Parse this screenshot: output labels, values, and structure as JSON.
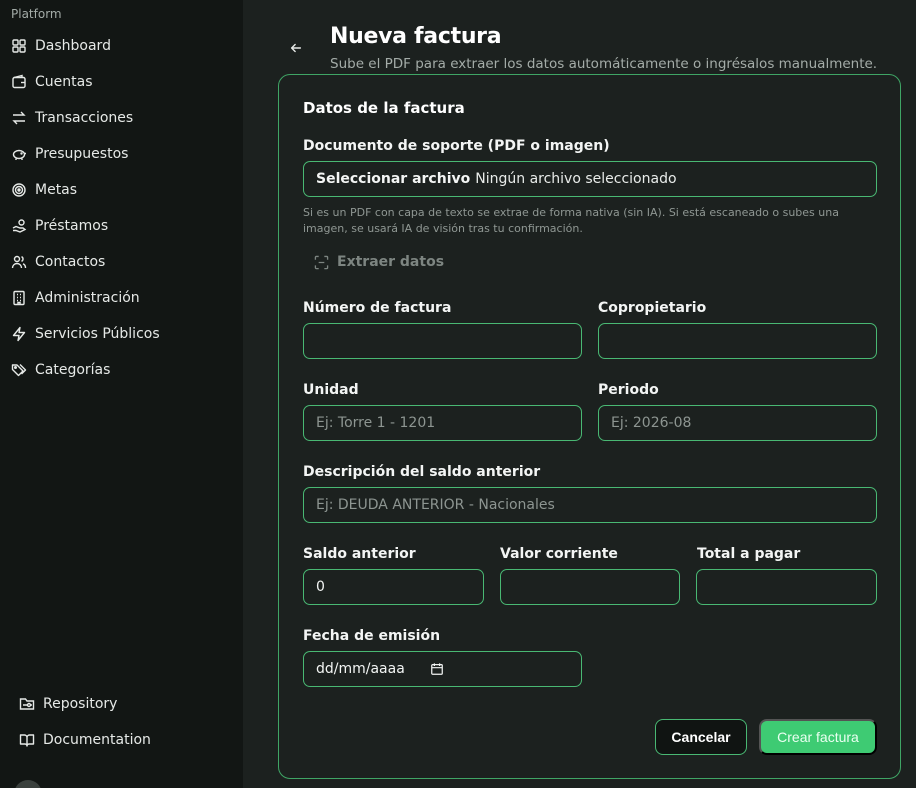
{
  "sidebar": {
    "section_label": "Platform",
    "items": [
      {
        "label": "Dashboard",
        "icon": "grid-icon"
      },
      {
        "label": "Cuentas",
        "icon": "wallet-icon"
      },
      {
        "label": "Transacciones",
        "icon": "arrows-swap-icon"
      },
      {
        "label": "Presupuestos",
        "icon": "piggy-bank-icon"
      },
      {
        "label": "Metas",
        "icon": "target-icon"
      },
      {
        "label": "Préstamos",
        "icon": "hand-coins-icon"
      },
      {
        "label": "Contactos",
        "icon": "users-icon"
      },
      {
        "label": "Administración",
        "icon": "building-icon"
      },
      {
        "label": "Servicios Públicos",
        "icon": "zap-icon"
      },
      {
        "label": "Categorías",
        "icon": "tags-icon"
      }
    ],
    "footer": [
      {
        "label": "Repository",
        "icon": "folder-git-icon"
      },
      {
        "label": "Documentation",
        "icon": "book-open-icon"
      }
    ]
  },
  "header": {
    "title": "Nueva factura",
    "subtitle": "Sube el PDF para extraer los datos automáticamente o ingrésalos manualmente."
  },
  "form": {
    "card_title": "Datos de la factura",
    "document": {
      "label": "Documento de soporte (PDF o imagen)",
      "button": "Seleccionar archivo",
      "status": "Ningún archivo seleccionado",
      "help": "Si es un PDF con capa de texto se extrae de forma nativa (sin IA). Si está escaneado o subes una imagen, se usará IA de visión tras tu confirmación."
    },
    "extract_label": "Extraer datos",
    "invoice_number": {
      "label": "Número de factura",
      "value": "",
      "placeholder": ""
    },
    "co_owner": {
      "label": "Copropietario",
      "value": "",
      "placeholder": ""
    },
    "unit": {
      "label": "Unidad",
      "value": "",
      "placeholder": "Ej: Torre 1 - 1201"
    },
    "period": {
      "label": "Periodo",
      "value": "",
      "placeholder": "Ej: 2026-08"
    },
    "prev_balance_desc": {
      "label": "Descripción del saldo anterior",
      "value": "",
      "placeholder": "Ej: DEUDA ANTERIOR - Nacionales"
    },
    "prev_balance": {
      "label": "Saldo anterior",
      "value": "0"
    },
    "current_value": {
      "label": "Valor corriente",
      "value": ""
    },
    "total": {
      "label": "Total a pagar",
      "value": ""
    },
    "issue_date": {
      "label": "Fecha de emisión",
      "value": "dd/mm/aaaa",
      "icon": "calendar-icon"
    },
    "cancel_label": "Cancelar",
    "submit_label": "Crear factura"
  },
  "colors": {
    "accent": "#3ecb73",
    "border": "#49b873",
    "sidebar_bg": "#121614",
    "main_bg": "#1c211f"
  }
}
